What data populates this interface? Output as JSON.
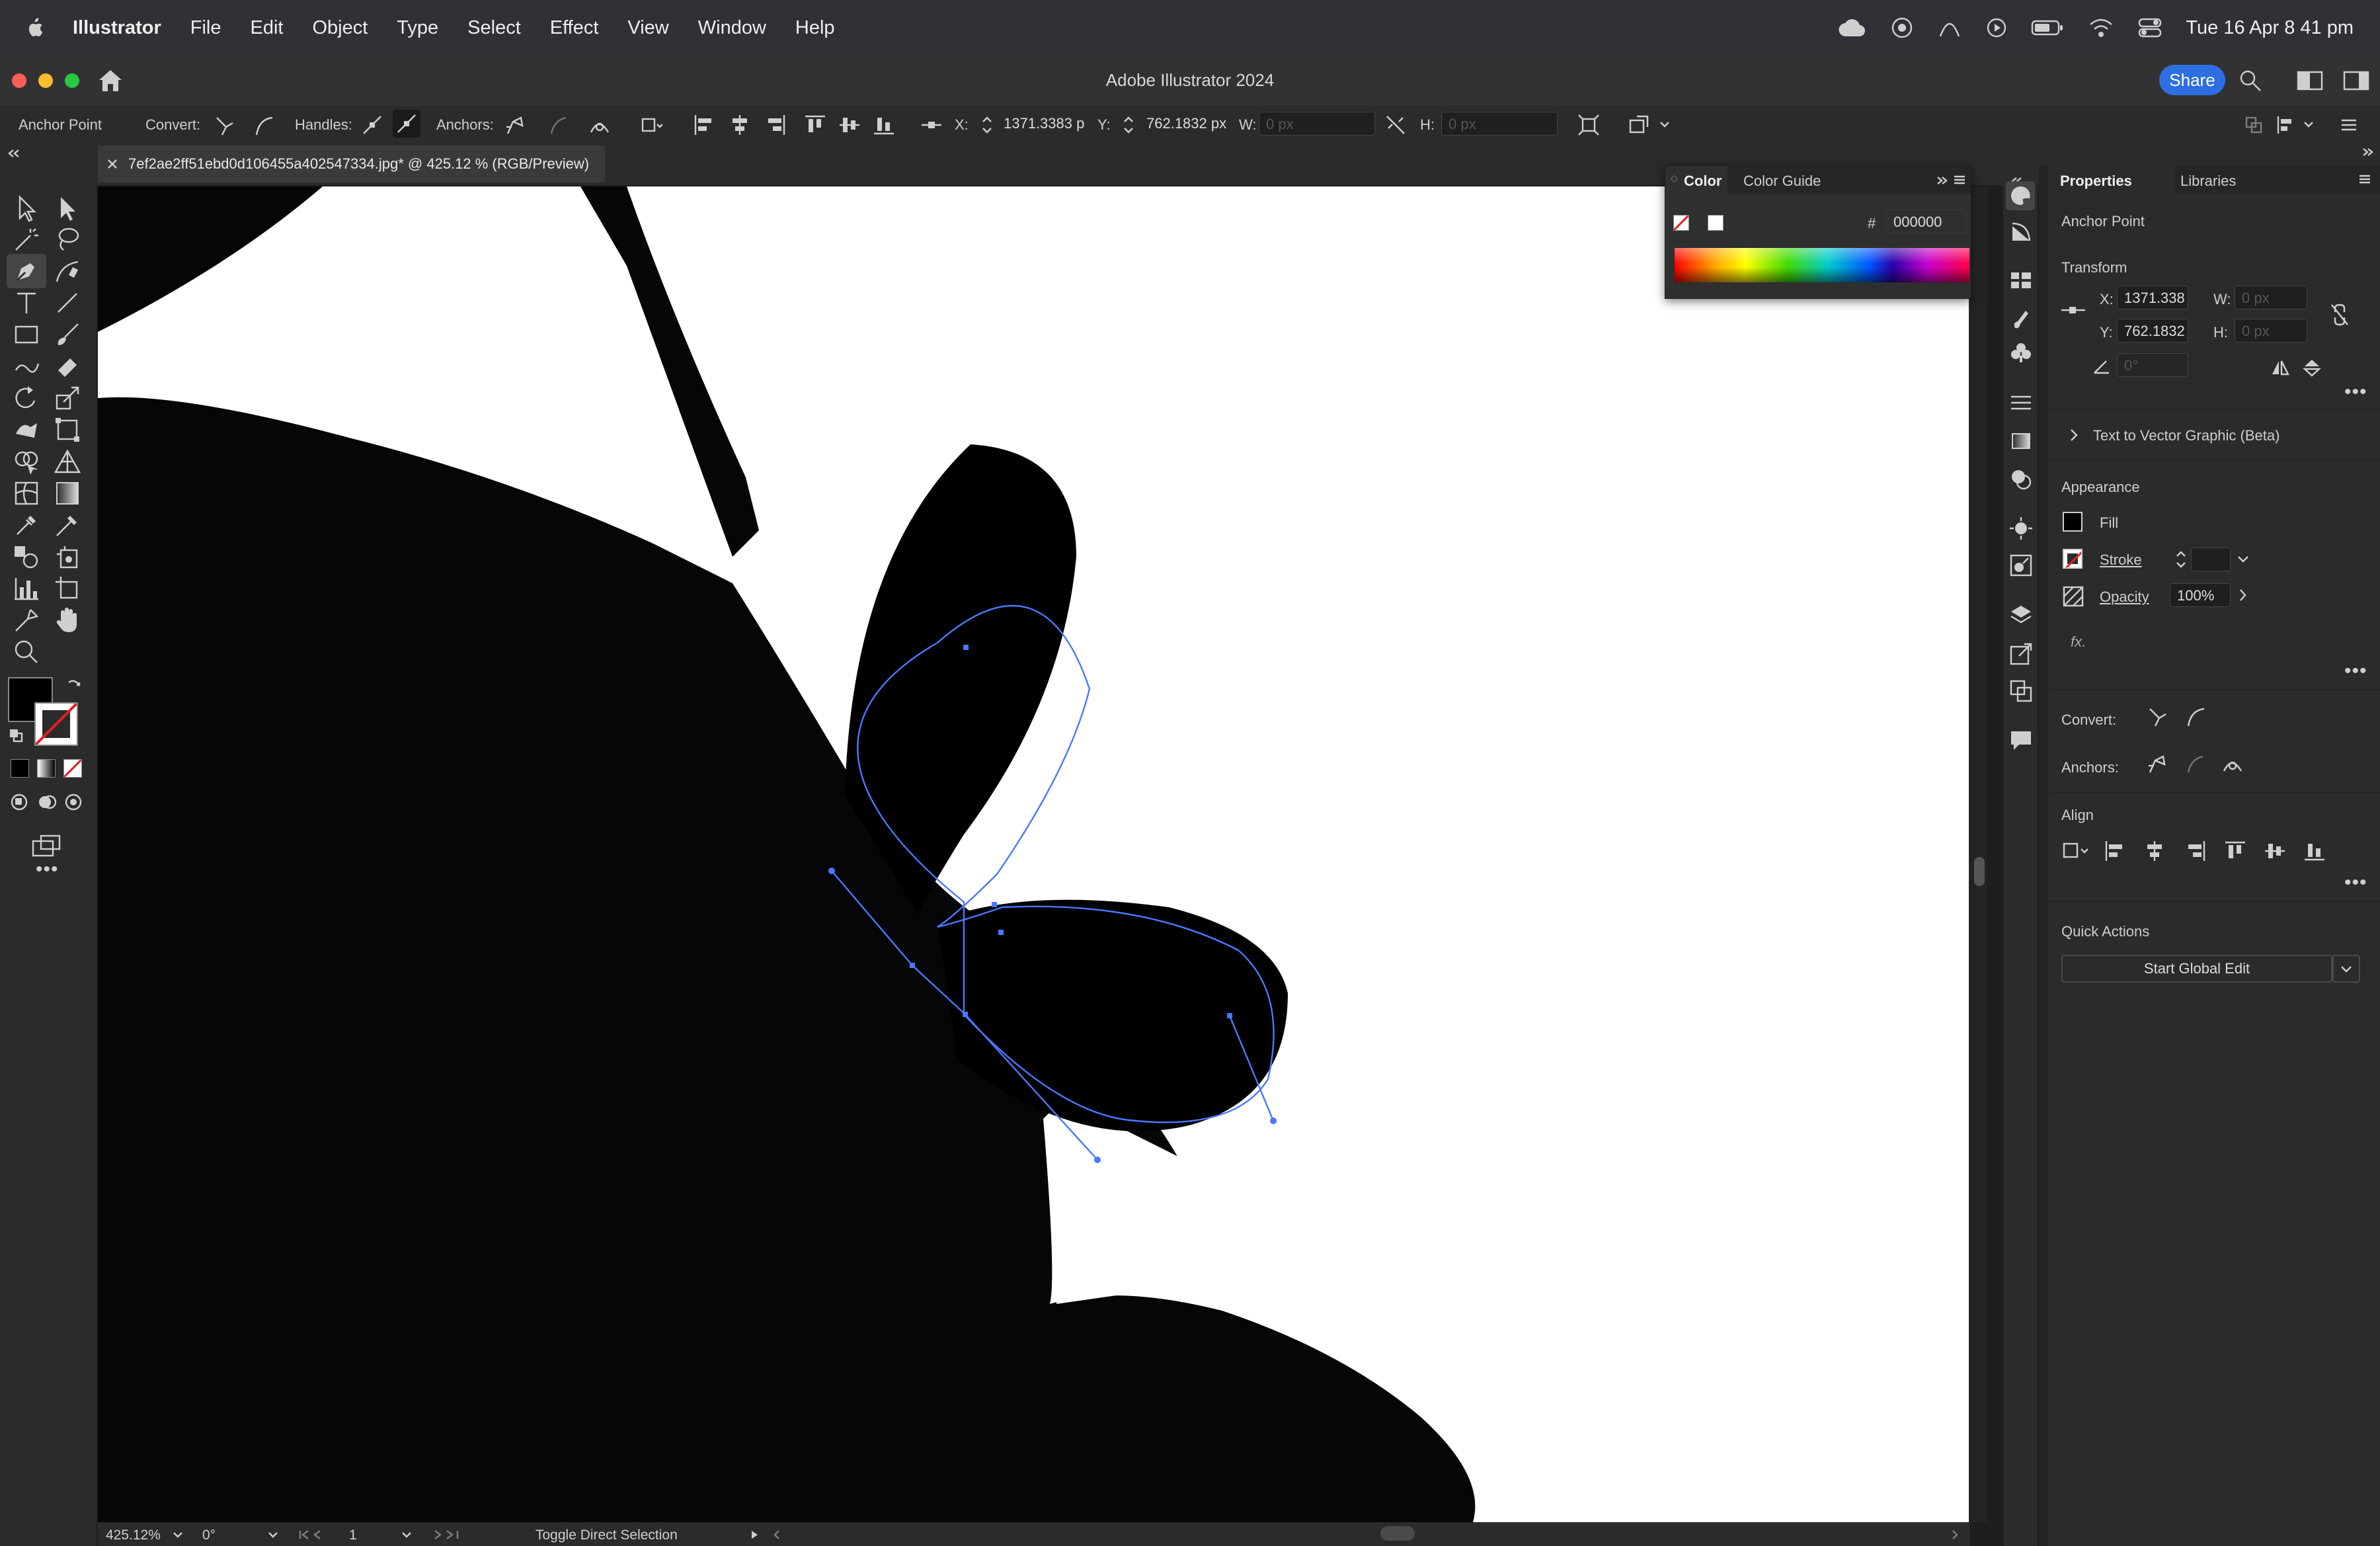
{
  "menubar": {
    "apple_icon": "apple-icon",
    "app_name": "Illustrator",
    "items": [
      "File",
      "Edit",
      "Object",
      "Type",
      "Select",
      "Effect",
      "View",
      "Window",
      "Help"
    ],
    "clock": "Tue 16 Apr  8 41 pm"
  },
  "titlebar": {
    "title": "Adobe Illustrator 2024",
    "share_label": "Share"
  },
  "controlbar": {
    "tool_label": "Anchor Point",
    "convert_label": "Convert:",
    "handles_label": "Handles:",
    "anchors_label": "Anchors:",
    "x_label": "X:",
    "x_value": "1371.3383 p",
    "y_label": "Y:",
    "y_value": "762.1832 px",
    "w_label": "W:",
    "w_value": "0 px",
    "h_label": "H:",
    "h_value": "0 px"
  },
  "document": {
    "tab_title": "7ef2ae2ff51ebd0d106455a402547334.jpg* @ 425.12 % (RGB/Preview)"
  },
  "statusbar": {
    "zoom": "425.12%",
    "rotation": "0°",
    "artboard": "1",
    "status_text": "Toggle Direct Selection"
  },
  "color_panel": {
    "tab_color": "Color",
    "tab_color_guide": "Color Guide",
    "hash": "#",
    "hex_value": "000000"
  },
  "properties": {
    "tab_properties": "Properties",
    "tab_libraries": "Libraries",
    "selection_type": "Anchor Point",
    "transform_title": "Transform",
    "x_label": "X:",
    "x_value": "1371.338",
    "y_label": "Y:",
    "y_value": "762.1832",
    "w_label": "W:",
    "w_value": "0 px",
    "h_label": "H:",
    "h_value": "0 px",
    "angle_value": "0°",
    "text_to_vector": "Text to Vector Graphic (Beta)",
    "appearance_title": "Appearance",
    "fill_label": "Fill",
    "stroke_label": "Stroke",
    "opacity_label": "Opacity",
    "opacity_value": "100%",
    "fx_label": "fx.",
    "convert_label": "Convert:",
    "anchors_label": "Anchors:",
    "align_title": "Align",
    "quick_actions_title": "Quick Actions",
    "global_edit_label": "Start Global Edit"
  },
  "colors": {
    "accent_blue": "#2d6fe0",
    "path_blue": "#4a78ff",
    "fill_black": "#000000",
    "panel_bg": "#2b2b2b"
  }
}
